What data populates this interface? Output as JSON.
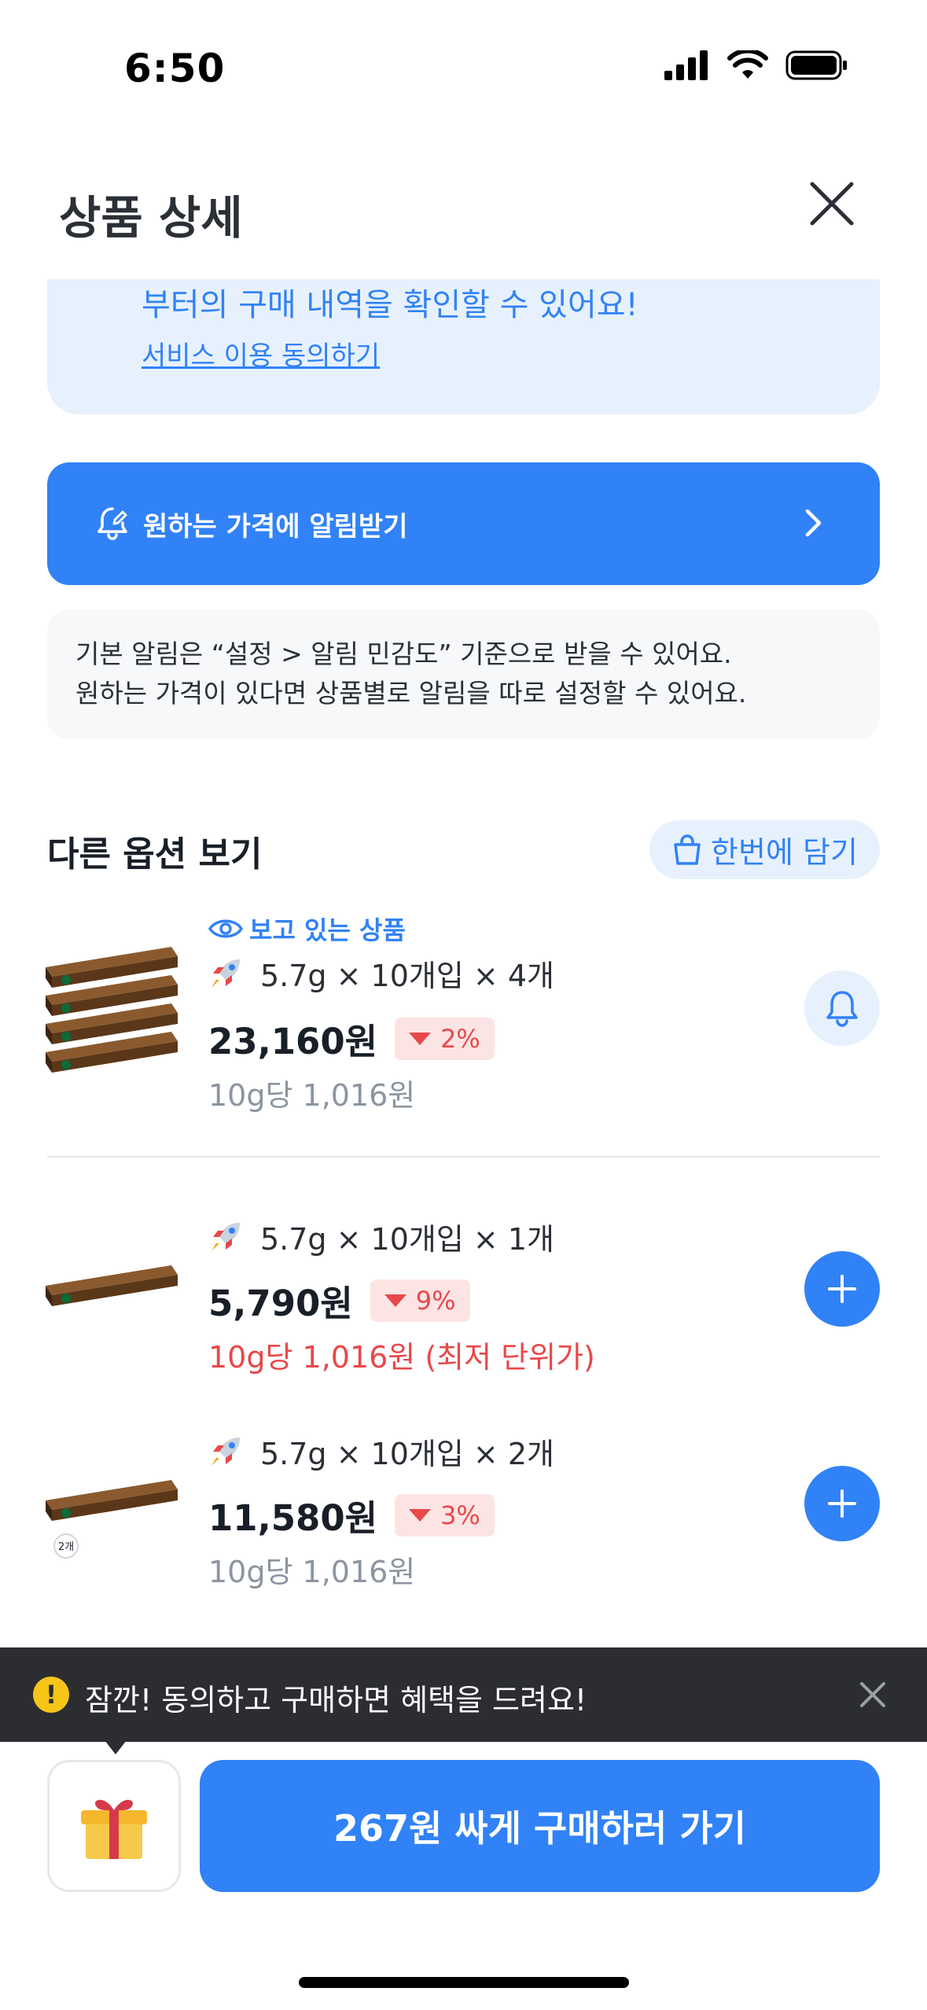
{
  "status_bar": {
    "time": "6:50"
  },
  "header": {
    "title": "상품 상세"
  },
  "consent_card": {
    "text": "부터의 구매 내역을 확인할 수 있어요!",
    "link": "서비스 이용 동의하기"
  },
  "alert_banner": {
    "label": "원하는 가격에 알림받기"
  },
  "info_box": {
    "line1": "기본 알림은 “설정 > 알림 민감도” 기준으로 받을 수 있어요.",
    "line2": "원하는 가격이 있다면 상품별로 알림을 따로 설정할 수 있어요."
  },
  "options_section": {
    "title": "다른 옵션 보기",
    "add_all_label": "한번에 담기",
    "items": [
      {
        "viewing_label": "보고 있는 상품",
        "spec": "5.7g × 10개입 × 4개",
        "price": "23,160원",
        "drop": "2%",
        "unit_price": "10g당 1,016원",
        "action": "bell-icon"
      },
      {
        "spec": "5.7g × 10개입 × 1개",
        "price": "5,790원",
        "drop": "9%",
        "unit_price": "10g당 1,016원 (최저 단위가)",
        "action": "plus-icon"
      },
      {
        "spec": "5.7g × 10개입 × 2개",
        "price": "11,580원",
        "drop": "3%",
        "unit_price": "10g당 1,016원",
        "qty_badge": "2개",
        "action": "plus-icon"
      }
    ]
  },
  "toast": {
    "text": "잠깐! 동의하고 구매하면 혜택을 드려요!"
  },
  "cta": {
    "label": "267원 싸게 구매하러 가기"
  },
  "colors": {
    "accent": "#3182f6",
    "accent_light": "#e7f1fd",
    "drop_red": "#e8484a",
    "toast_bg": "#2b2d31"
  }
}
